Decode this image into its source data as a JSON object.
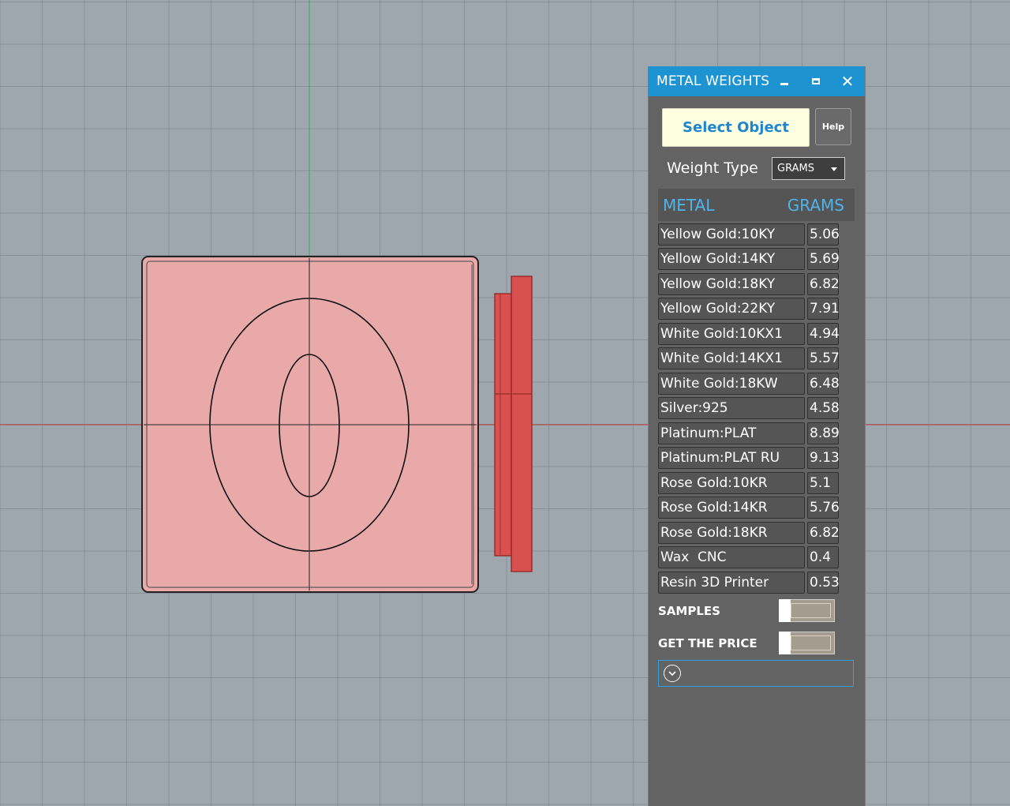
{
  "window": {
    "title": "METAL WEIGHTS",
    "minimize_icon": "minimize-icon",
    "maximize_icon": "maximize-icon",
    "close_icon": "close-icon",
    "close_glyph": "✕"
  },
  "buttons": {
    "select_object": "Select Object",
    "help": "Help"
  },
  "weight_type": {
    "label": "Weight Type",
    "selected": "GRAMS"
  },
  "table": {
    "headers": {
      "metal": "METAL",
      "unit": "GRAMS"
    },
    "rows": [
      {
        "metal": "Yellow Gold:10KY",
        "value": "5.06"
      },
      {
        "metal": "Yellow Gold:14KY",
        "value": "5.69"
      },
      {
        "metal": "Yellow Gold:18KY",
        "value": "6.82"
      },
      {
        "metal": "Yellow Gold:22KY",
        "value": "7.91"
      },
      {
        "metal": "White Gold:10KX1",
        "value": "4.94"
      },
      {
        "metal": "White Gold:14KX1",
        "value": "5.57"
      },
      {
        "metal": "White Gold:18KW",
        "value": "6.48"
      },
      {
        "metal": "Silver:925",
        "value": "4.58"
      },
      {
        "metal": "Platinum:PLAT",
        "value": "8.89"
      },
      {
        "metal": "Platinum:PLAT RU",
        "value": "9.13"
      },
      {
        "metal": "Rose Gold:10KR",
        "value": "5.1"
      },
      {
        "metal": "Rose Gold:14KR",
        "value": "5.76"
      },
      {
        "metal": "Rose Gold:18KR",
        "value": "6.82"
      },
      {
        "metal": "Wax  CNC",
        "value": "0.4"
      },
      {
        "metal": "Resin 3D Printer",
        "value": "0.53"
      }
    ]
  },
  "toggles": {
    "samples": {
      "label": "SAMPLES",
      "on": false
    },
    "get_price": {
      "label": "GET THE PRICE",
      "on": false
    }
  },
  "colors": {
    "accent": "#1d93d1",
    "header_text": "#4fb3ec",
    "viewport_bg": "#9ea6ae",
    "object_fill": "#eaa9a9",
    "side_object_fill": "#d9504e",
    "x_axis": "#b2433a",
    "y_axis": "#3bb04a"
  }
}
